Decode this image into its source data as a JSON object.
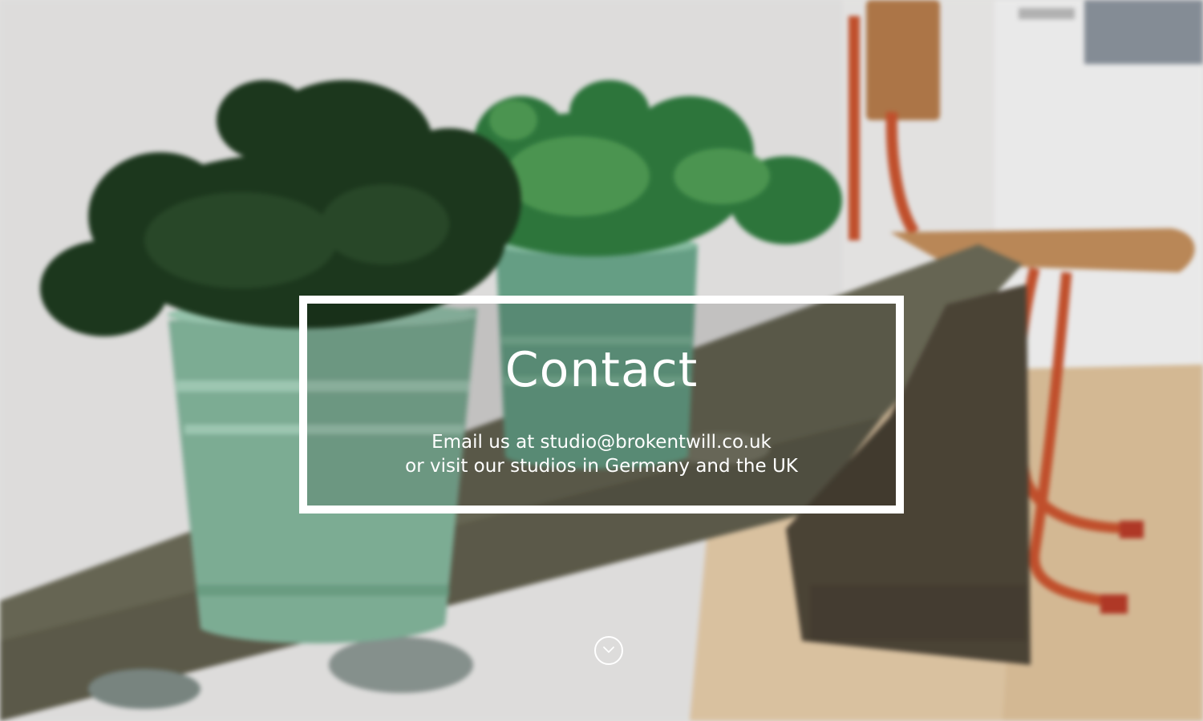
{
  "hero": {
    "title": "Contact",
    "line1": "Email us at studio@brokentwill.co.uk",
    "line2": "or visit our studios in Germany and the UK"
  },
  "scroll": {
    "icon": "chevron-down-icon"
  },
  "colors": {
    "frame": "#ffffff",
    "text": "#ffffff",
    "wall": "#ecebea",
    "pot": "#82b39a",
    "bench": "#6b6a57",
    "chair_wood": "#b47a4a",
    "chair_frame": "#c8532e",
    "floor": "#e2c9a6"
  }
}
